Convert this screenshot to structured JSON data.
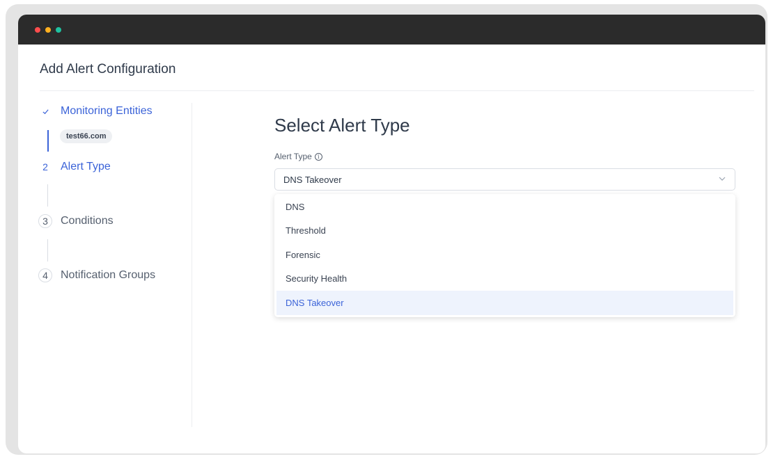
{
  "page": {
    "title": "Add Alert Configuration"
  },
  "stepper": {
    "steps": [
      {
        "number": "✓",
        "label": "Monitoring Entities",
        "state": "done"
      },
      {
        "number": "2",
        "label": "Alert Type",
        "state": "active"
      },
      {
        "number": "3",
        "label": "Conditions",
        "state": "pending"
      },
      {
        "number": "4",
        "label": "Notification Groups",
        "state": "pending"
      }
    ],
    "selected_entity": "test66.com"
  },
  "main": {
    "section_title": "Select Alert Type",
    "field_label": "Alert Type",
    "info_glyph": "i",
    "selected_value": "DNS Takeover",
    "options": [
      "DNS",
      "Threshold",
      "Forensic",
      "Security Health",
      "DNS Takeover"
    ]
  },
  "colors": {
    "accent": "#3b63d8",
    "titlebar": "#2b2b2b",
    "selected_bg": "#eef3fd"
  }
}
